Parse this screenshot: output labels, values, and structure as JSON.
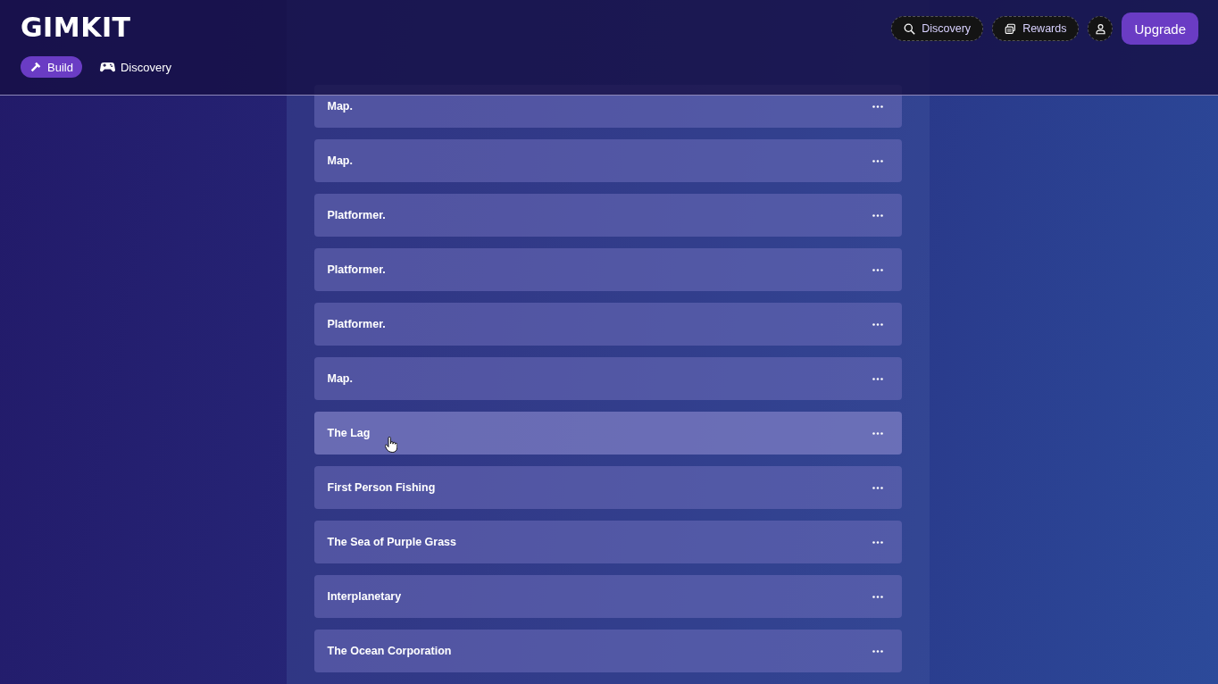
{
  "header": {
    "logo": "GIMKIT",
    "nav": [
      {
        "label": "Build",
        "selected": true
      },
      {
        "label": "Discovery",
        "selected": false
      }
    ],
    "actions": [
      {
        "kind": "pill",
        "label": "Discovery"
      },
      {
        "kind": "pill",
        "label": "Rewards"
      },
      {
        "kind": "avatar"
      },
      {
        "kind": "primary",
        "label": "Upgrade"
      }
    ]
  },
  "rows": [
    {
      "title": "Map.",
      "hovered": false
    },
    {
      "title": "Map.",
      "hovered": false
    },
    {
      "title": "Platformer.",
      "hovered": false
    },
    {
      "title": "Platformer.",
      "hovered": false
    },
    {
      "title": "Platformer.",
      "hovered": false
    },
    {
      "title": "Map.",
      "hovered": false
    },
    {
      "title": "The Lag",
      "hovered": true
    },
    {
      "title": "First Person Fishing",
      "hovered": false
    },
    {
      "title": "The Sea of Purple Grass",
      "hovered": false
    },
    {
      "title": "Interplanetary",
      "hovered": false
    },
    {
      "title": "The Ocean Corporation",
      "hovered": false
    }
  ]
}
